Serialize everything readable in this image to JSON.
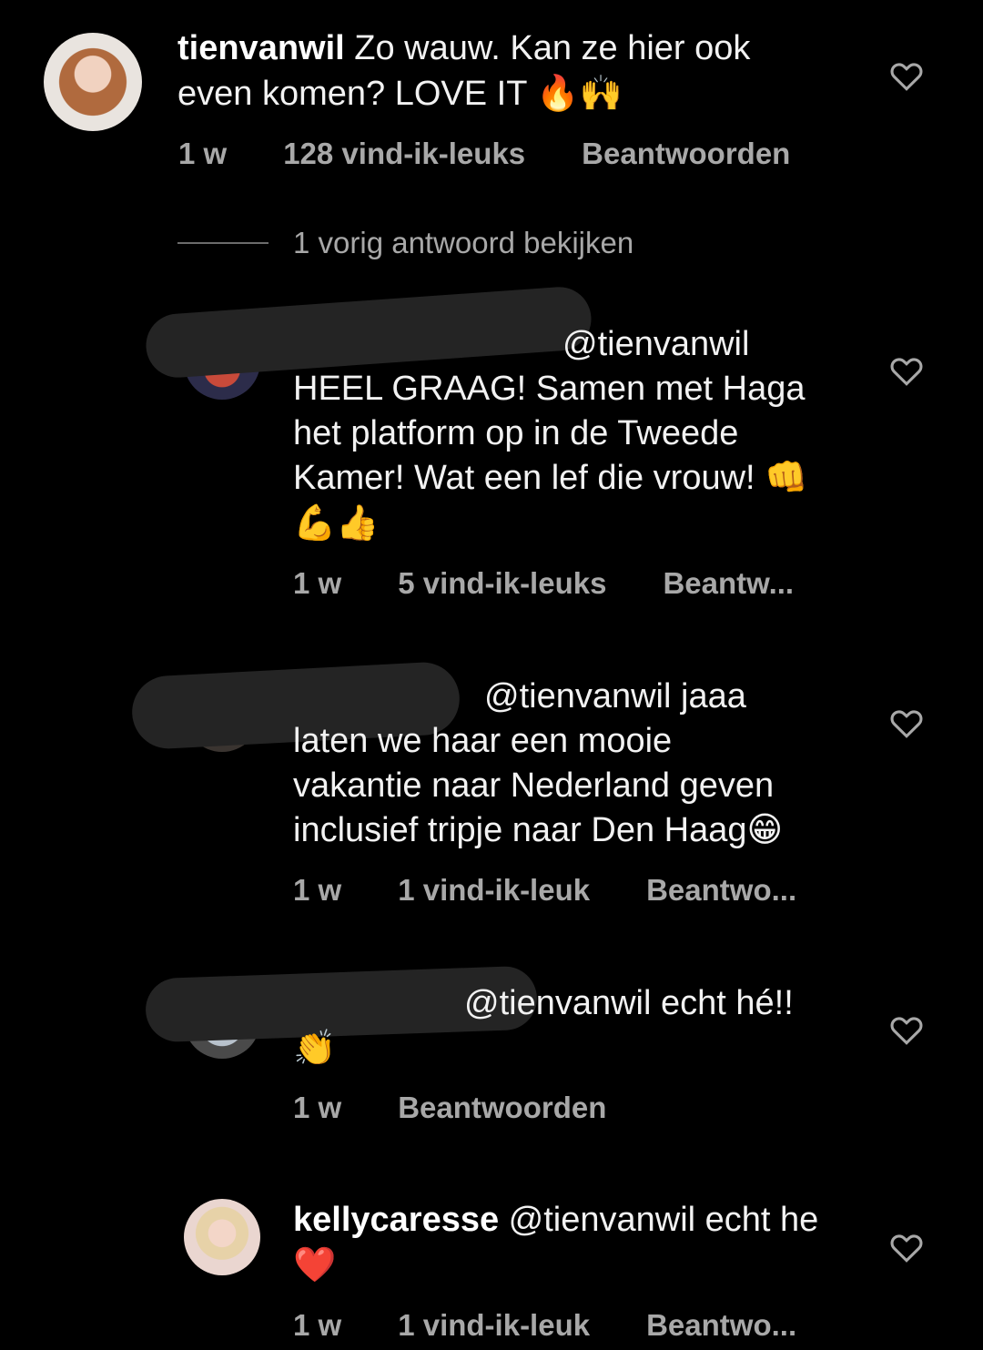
{
  "top_comment": {
    "username": "tienvanwil",
    "text_line1": "Zo wauw. Kan ze hier ook",
    "text_line2": "even komen? LOVE IT",
    "emoji": "🔥🙌",
    "time": "1 w",
    "likes": "128 vind-ik-leuks",
    "reply": "Beantwoorden"
  },
  "view_replies": "1 vorig antwoord bekijken",
  "replies": [
    {
      "username_visible": "",
      "line1": "@tienvanwil",
      "line2": "HEEL GRAAG! Samen met Haga",
      "line3": "het platform op in de Tweede",
      "line4": "Kamer! Wat een lef die vrouw! 👊",
      "line5": "💪👍",
      "time": "1 w",
      "likes": "5 vind-ik-leuks",
      "reply": "Beantw..."
    },
    {
      "line1": "@tienvanwil jaaa",
      "line2": "laten we haar een mooie",
      "line3": "vakantie naar Nederland geven",
      "line4": "inclusief tripje naar Den Haag😁",
      "time": "1 w",
      "likes": "1 vind-ik-leuk",
      "reply": "Beantwo..."
    },
    {
      "line1": "@tienvanwil echt hé!!",
      "line2": "👏",
      "time": "1 w",
      "reply": "Beantwoorden"
    },
    {
      "username": "kellycaresse",
      "line1": "@tienvanwil echt he",
      "line2": "❤️",
      "time": "1 w",
      "likes": "1 vind-ik-leuk",
      "reply": "Beantwo..."
    }
  ],
  "colors": {
    "background": "#000000",
    "text": "#f2f2f2",
    "meta": "#a8a8a8"
  },
  "icons": [
    "heart-icon"
  ]
}
